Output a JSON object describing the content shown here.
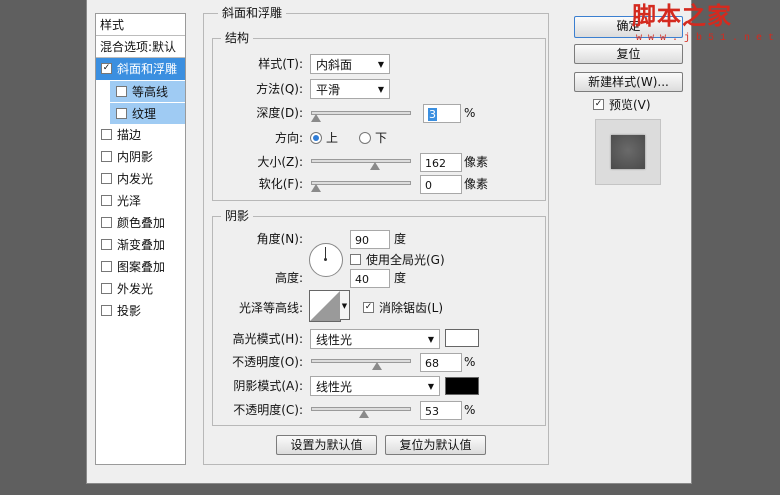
{
  "left_panel": {
    "header": "样式",
    "blend": "混合选项:默认",
    "items": [
      {
        "label": "斜面和浮雕",
        "checked": true,
        "state": "selected"
      },
      {
        "label": "等高线",
        "checked": false,
        "state": "sub"
      },
      {
        "label": "纹理",
        "checked": false,
        "state": "sub"
      },
      {
        "label": "描边",
        "checked": false,
        "state": "normal"
      },
      {
        "label": "内阴影",
        "checked": false,
        "state": "normal"
      },
      {
        "label": "内发光",
        "checked": false,
        "state": "normal"
      },
      {
        "label": "光泽",
        "checked": false,
        "state": "normal"
      },
      {
        "label": "颜色叠加",
        "checked": false,
        "state": "normal"
      },
      {
        "label": "渐变叠加",
        "checked": false,
        "state": "normal"
      },
      {
        "label": "图案叠加",
        "checked": false,
        "state": "normal"
      },
      {
        "label": "外发光",
        "checked": false,
        "state": "normal"
      },
      {
        "label": "投影",
        "checked": false,
        "state": "normal"
      }
    ]
  },
  "bevel": {
    "title": "斜面和浮雕",
    "structure": {
      "title": "结构",
      "style_label": "样式(T):",
      "style_value": "内斜面",
      "technique_label": "方法(Q):",
      "technique_value": "平滑",
      "depth_label": "深度(D):",
      "depth_value": "3",
      "depth_unit": "%",
      "depth_fraction": 0.0,
      "direction_label": "方向:",
      "dir_up": "上",
      "dir_down": "下",
      "size_label": "大小(Z):",
      "size_value": "162",
      "size_unit": "像素",
      "size_fraction": 0.66,
      "soften_label": "软化(F):",
      "soften_value": "0",
      "soften_unit": "像素",
      "soften_fraction": 0.0
    },
    "shading": {
      "title": "阴影",
      "angle_label": "角度(N):",
      "angle_value": "90",
      "angle_unit": "度",
      "global_light_label": "使用全局光(G)",
      "global_light_checked": false,
      "altitude_label": "高度:",
      "altitude_value": "40",
      "altitude_unit": "度",
      "gloss_label": "光泽等高线:",
      "antialias_label": "消除锯齿(L)",
      "antialias_checked": true,
      "highlight_mode_label": "高光模式(H):",
      "highlight_mode_value": "线性光",
      "highlight_color": "#ffffff",
      "highlight_opacity_label": "不透明度(O):",
      "highlight_opacity_value": "68",
      "highlight_opacity_unit": "%",
      "highlight_opacity_fraction": 0.68,
      "shadow_mode_label": "阴影模式(A):",
      "shadow_mode_value": "线性光",
      "shadow_color": "#000000",
      "shadow_opacity_label": "不透明度(C):",
      "shadow_opacity_value": "53",
      "shadow_opacity_unit": "%",
      "shadow_opacity_fraction": 0.53
    },
    "make_default": "设置为默认值",
    "reset_default": "复位为默认值"
  },
  "right": {
    "ok": "确定",
    "reset": "复位",
    "new_style": "新建样式(W)...",
    "preview_label": "预览(V)",
    "preview_checked": true
  },
  "watermark": {
    "brand": "脚本之家",
    "url": "w w w . j b 5 1 . n e t"
  },
  "colors": {
    "selected": "#3b8fe0",
    "sub": "#9fcbf3",
    "watermark": "#d42a1f"
  }
}
